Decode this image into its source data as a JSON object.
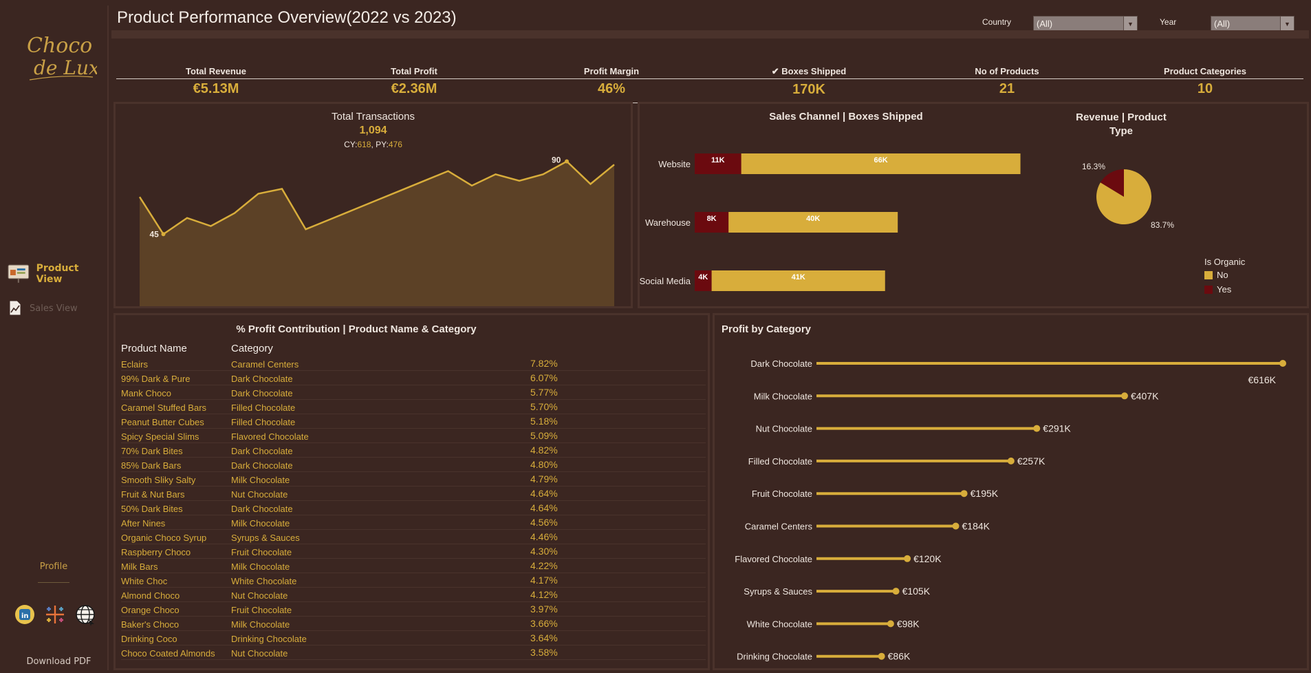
{
  "sidebar": {
    "logo_text_line1": "Choco",
    "logo_text_line2": "de Luxe",
    "nav_product": "Product View",
    "nav_sales": "Sales View",
    "profile": "Profile",
    "download": "Download PDF",
    "social_icons": [
      "linkedin-icon",
      "tableau-icon",
      "globe-icon"
    ]
  },
  "header": {
    "title": "Product Performance Overview(2022 vs 2023)",
    "country_label": "Country",
    "country_value": "(All)",
    "year_label": "Year",
    "year_value": "(All)"
  },
  "kpis": [
    {
      "label": "Total Revenue",
      "value": "€5.13M"
    },
    {
      "label": "Total Profit",
      "value": "€2.36M"
    },
    {
      "label": "Profit Margin",
      "value": "46%"
    },
    {
      "label": "✔ Boxes Shipped",
      "value": "170K"
    },
    {
      "label": "No of Products",
      "value": "21"
    },
    {
      "label": "Product Categories",
      "value": "10"
    }
  ],
  "colors": {
    "gold": "#d8ad3b",
    "maroon": "#6b0a0f",
    "area_fill": "#5c4126",
    "background": "#3b2621"
  },
  "chart_data": [
    {
      "type": "area",
      "title": "Total Transactions",
      "total": "1,094",
      "cy_label": "CY:",
      "cy_value": "618",
      "py_label": "PY:",
      "py_value": "476",
      "values": [
        68,
        45,
        55,
        50,
        58,
        70,
        73,
        48,
        54,
        60,
        66,
        72,
        78,
        84,
        75,
        82,
        78,
        82,
        90,
        76,
        88
      ],
      "min_label": "45",
      "max_label": "90",
      "ylim": [
        0,
        100
      ]
    },
    {
      "type": "bar",
      "title": "Sales Channel | Boxes Shipped",
      "categories": [
        "Website",
        "Warehouse",
        "Social Media"
      ],
      "series": [
        {
          "name": "Yes",
          "values": [
            11,
            8,
            4
          ],
          "labels": [
            "11K",
            "8K",
            "4K"
          ]
        },
        {
          "name": "No",
          "values": [
            66,
            40,
            41
          ],
          "labels": [
            "66K",
            "40K",
            "41K"
          ]
        }
      ],
      "legend_title": "Is Organic",
      "legend_position": "bottom-right"
    },
    {
      "type": "pie",
      "title": "Revenue | Product Type",
      "slices": [
        {
          "name": "No",
          "value": 83.7,
          "label": "83.7%"
        },
        {
          "name": "Yes",
          "value": 16.3,
          "label": "16.3%"
        }
      ]
    },
    {
      "type": "table",
      "title": "% Profit Contribution | Product Name & Category",
      "columns": [
        "Product Name",
        "Category"
      ],
      "rows": [
        [
          "Eclairs",
          "Caramel Centers",
          "7.82%"
        ],
        [
          "99% Dark & Pure",
          "Dark Chocolate",
          "6.07%"
        ],
        [
          "Mank Choco",
          "Dark Chocolate",
          "5.77%"
        ],
        [
          "Caramel Stuffed Bars",
          "Filled Chocolate",
          "5.70%"
        ],
        [
          "Peanut Butter Cubes",
          "Filled Chocolate",
          "5.18%"
        ],
        [
          "Spicy Special Slims",
          "Flavored Chocolate",
          "5.09%"
        ],
        [
          "70% Dark Bites",
          "Dark Chocolate",
          "4.82%"
        ],
        [
          "85% Dark Bars",
          "Dark Chocolate",
          "4.80%"
        ],
        [
          "Smooth Sliky Salty",
          "Milk Chocolate",
          "4.79%"
        ],
        [
          "Fruit & Nut Bars",
          "Nut Chocolate",
          "4.64%"
        ],
        [
          "50% Dark Bites",
          "Dark Chocolate",
          "4.64%"
        ],
        [
          "After Nines",
          "Milk Chocolate",
          "4.56%"
        ],
        [
          "Organic Choco Syrup",
          "Syrups & Sauces",
          "4.46%"
        ],
        [
          "Raspberry Choco",
          "Fruit Chocolate",
          "4.30%"
        ],
        [
          "Milk Bars",
          "Milk Chocolate",
          "4.22%"
        ],
        [
          "White Choc",
          "White Chocolate",
          "4.17%"
        ],
        [
          "Almond Choco",
          "Nut Chocolate",
          "4.12%"
        ],
        [
          "Orange Choco",
          "Fruit Chocolate",
          "3.97%"
        ],
        [
          "Baker's Choco",
          "Milk Chocolate",
          "3.66%"
        ],
        [
          "Drinking Coco",
          "Drinking Chocolate",
          "3.64%"
        ],
        [
          "Choco Coated Almonds",
          "Nut Chocolate",
          "3.58%"
        ]
      ]
    },
    {
      "type": "bar",
      "title": "Profit by Category",
      "categories": [
        "Dark Chocolate",
        "Milk Chocolate",
        "Nut Chocolate",
        "Filled Chocolate",
        "Fruit Chocolate",
        "Caramel Centers",
        "Flavored Chocolate",
        "Syrups & Sauces",
        "White Chocolate",
        "Drinking Chocolate"
      ],
      "values": [
        616,
        407,
        291,
        257,
        195,
        184,
        120,
        105,
        98,
        86
      ],
      "labels": [
        "€616K",
        "€407K",
        "€291K",
        "€257K",
        "€195K",
        "€184K",
        "€120K",
        "€105K",
        "€98K",
        "€86K"
      ]
    }
  ]
}
